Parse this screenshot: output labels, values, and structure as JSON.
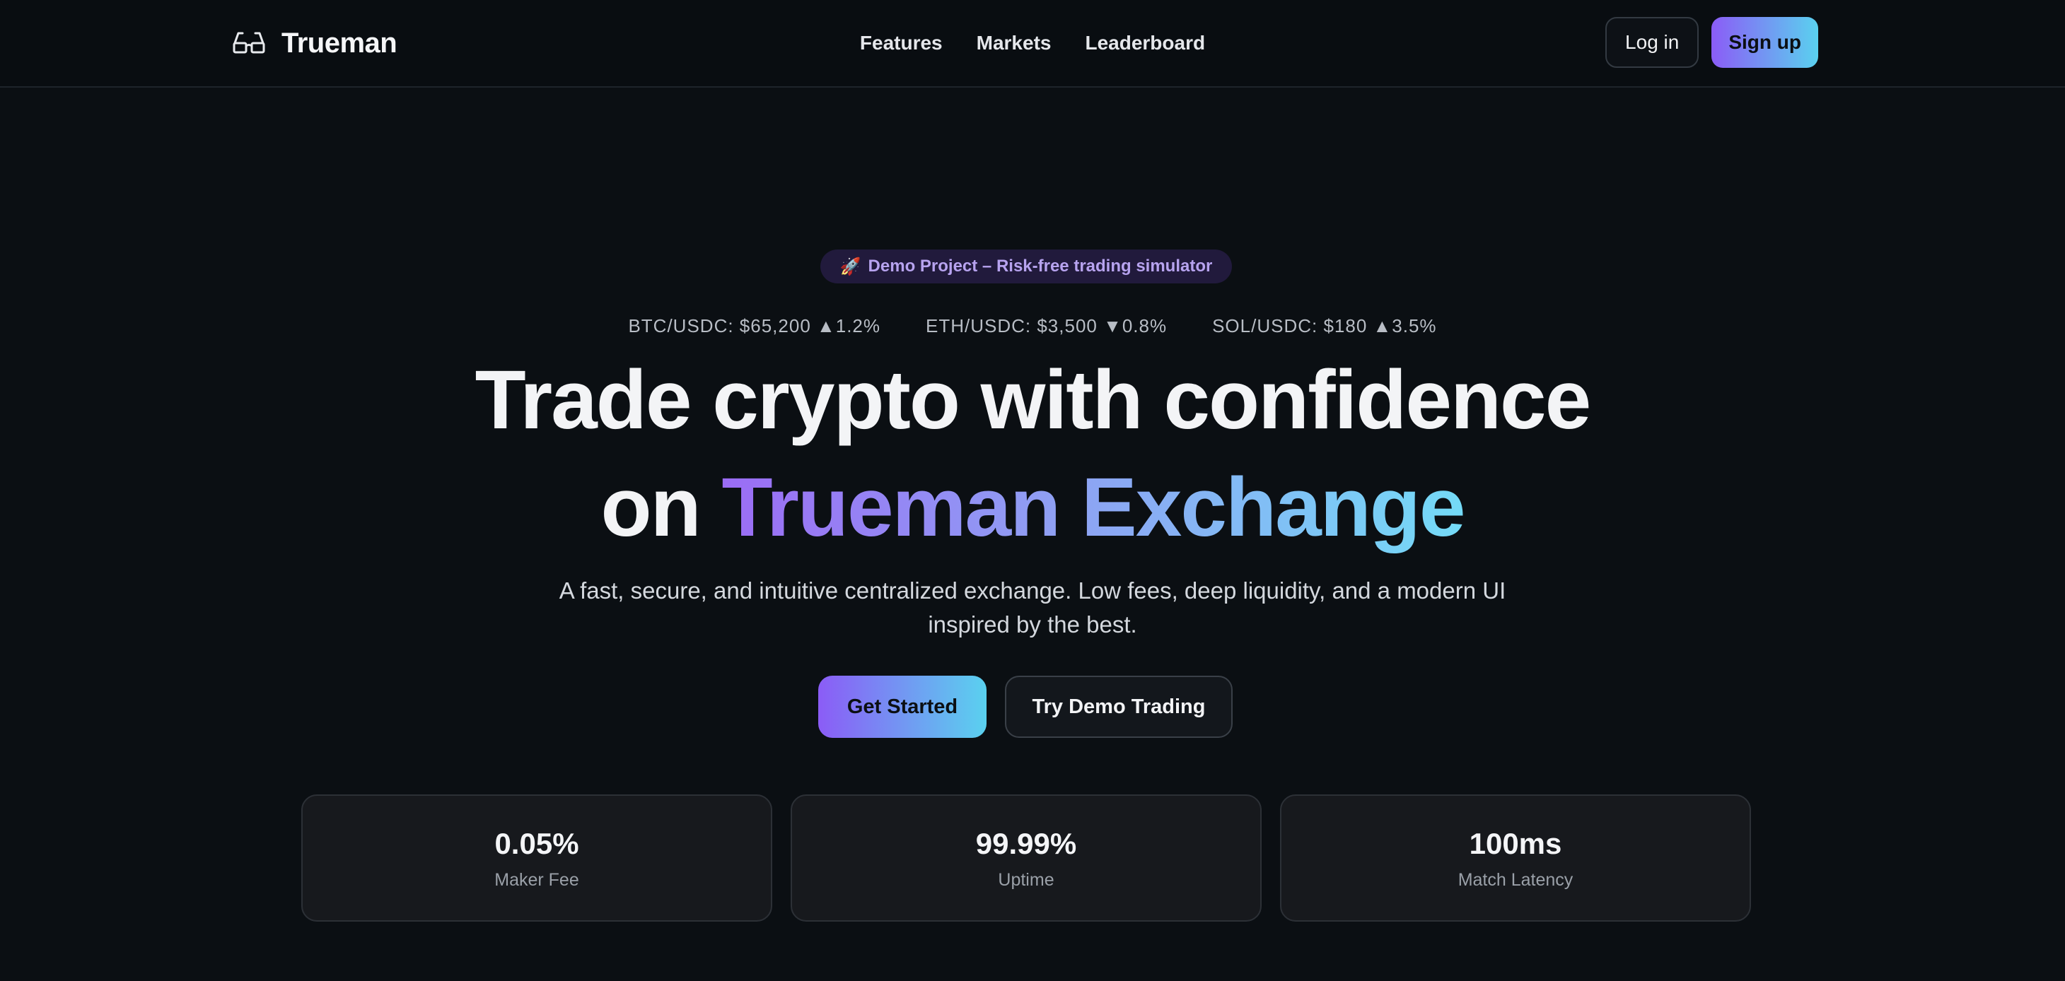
{
  "brand": {
    "name": "Trueman",
    "icon": "glasses-icon"
  },
  "nav": {
    "items": [
      {
        "label": "Features"
      },
      {
        "label": "Markets"
      },
      {
        "label": "Leaderboard"
      }
    ]
  },
  "auth": {
    "login_label": "Log in",
    "signup_label": "Sign up"
  },
  "hero": {
    "badge": {
      "icon": "rocket-icon",
      "icon_glyph": "🚀",
      "text": "Demo Project – Risk-free trading simulator"
    },
    "ticker": [
      {
        "text": "BTC/USDC: $65,200 ▲1.2%"
      },
      {
        "text": "ETH/USDC: $3,500 ▼0.8%"
      },
      {
        "text": "SOL/USDC: $180 ▲3.5%"
      }
    ],
    "headline_line1": "Trade crypto with confidence",
    "headline_line2_prefix": "on ",
    "headline_line2_highlight": "Trueman Exchange",
    "subtext": "A fast, secure, and intuitive centralized exchange. Low fees, deep liquidity, and a modern UI inspired by the best.",
    "primary_cta": "Get Started",
    "secondary_cta": "Try Demo Trading"
  },
  "stats": [
    {
      "value": "0.05%",
      "label": "Maker Fee"
    },
    {
      "value": "99.99%",
      "label": "Uptime"
    },
    {
      "value": "100ms",
      "label": "Match Latency"
    }
  ],
  "colors": {
    "background": "#0b0f13",
    "accent_start": "#8b5cf6",
    "accent_end": "#5ad1ef",
    "badge_bg": "#211a3c",
    "badge_text": "#b7a3ef"
  }
}
